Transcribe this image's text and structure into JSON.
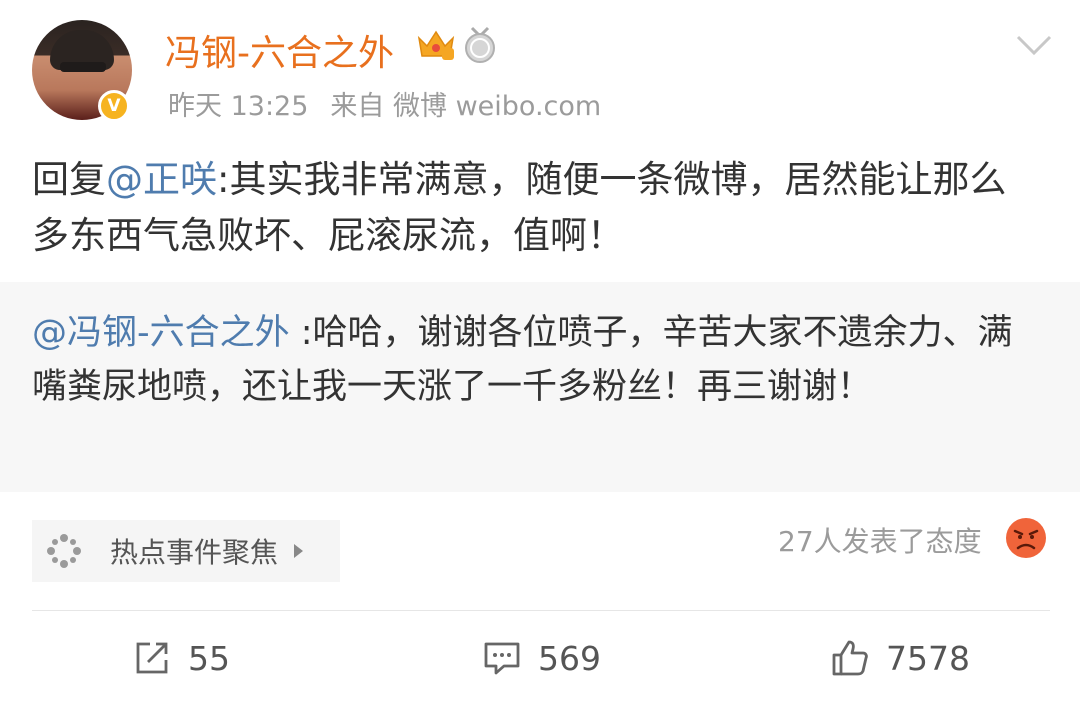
{
  "post": {
    "username": "冯钢-六合之外",
    "time": "昨天 13:25",
    "source": "来自 微博 weibo.com",
    "text_prefix": "回复",
    "mention": "@正咲",
    "text_body": ":其实我非常满意，随便一条微博，居然能让那么多东西气急败坏、屁滚尿流，值啊！"
  },
  "repost": {
    "mention": "@冯钢-六合之外",
    "text": " :哈哈，谢谢各位喷子，辛苦大家不遗余力、满嘴粪尿地喷，还让我一天涨了一千多粉丝！再三谢谢！"
  },
  "topic": {
    "label": "热点事件聚焦"
  },
  "reactions": {
    "label": "27人发表了态度"
  },
  "actions": {
    "repost_count": "55",
    "comment_count": "569",
    "like_count": "7578"
  },
  "colors": {
    "username": "#e8701e",
    "mention": "#4f7cae",
    "verified_badge": "#f6b320"
  },
  "icons": [
    "verified-icon",
    "crown-level-icon",
    "medal-icon",
    "chevron-down-icon",
    "topic-dots-icon",
    "angry-face-icon",
    "repost-icon",
    "comment-icon",
    "like-icon"
  ]
}
